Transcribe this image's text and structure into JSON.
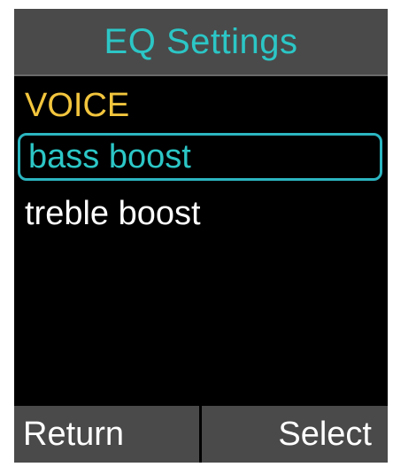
{
  "app": {
    "title": "EQ Settings"
  },
  "menu": {
    "items": [
      {
        "label": "VOICE",
        "state": "header"
      },
      {
        "label": "bass boost",
        "state": "selected"
      },
      {
        "label": "treble boost",
        "state": "normal"
      }
    ]
  },
  "softkeys": {
    "left_label": "Return",
    "right_label": "Select"
  },
  "colors": {
    "title": "#2cc6c6",
    "header_item": "#f2c53d",
    "selection_border": "#2bb5c0",
    "bar_background": "#4a4a4a",
    "screen_background": "#000000"
  }
}
